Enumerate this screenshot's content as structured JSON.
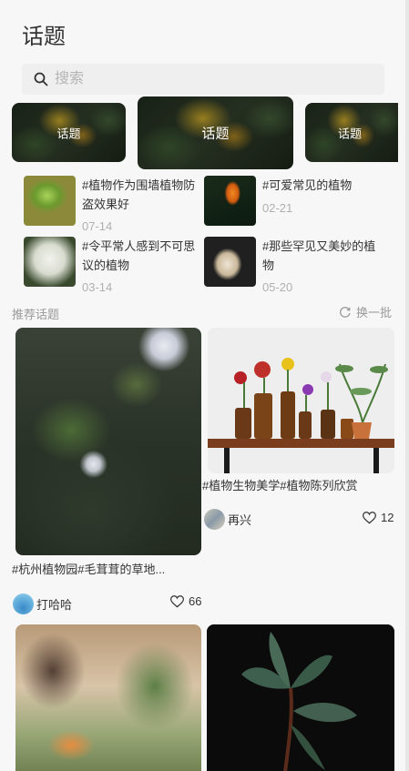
{
  "header": {
    "title": "话题"
  },
  "search": {
    "placeholder": "搜索",
    "icon": "search-icon"
  },
  "banners": [
    {
      "label": "话题"
    },
    {
      "label": "话题"
    },
    {
      "label": "话题"
    }
  ],
  "topics": [
    {
      "title": "#植物作为围墙植物防盗效果好",
      "date": "07-14"
    },
    {
      "title": "#可爱常见的植物",
      "date": "02-21"
    },
    {
      "title": "#令平常人感到不可思议的植物",
      "date": "03-14"
    },
    {
      "title": "#那些罕见又美妙的植物",
      "date": "05-20"
    }
  ],
  "recommended": {
    "title": "推荐话题",
    "refresh_label": "换一批"
  },
  "posts": [
    {
      "caption": "#杭州植物园#毛茸茸的草地...",
      "user": "打哈哈",
      "likes": "66"
    },
    {
      "caption": "#植物生物美学#植物陈列欣赏",
      "user": "再兴",
      "likes": "12"
    }
  ],
  "colors": {
    "background": "#f7f7f8",
    "search_bg": "#efefef",
    "date_text": "#b0b0b0"
  }
}
